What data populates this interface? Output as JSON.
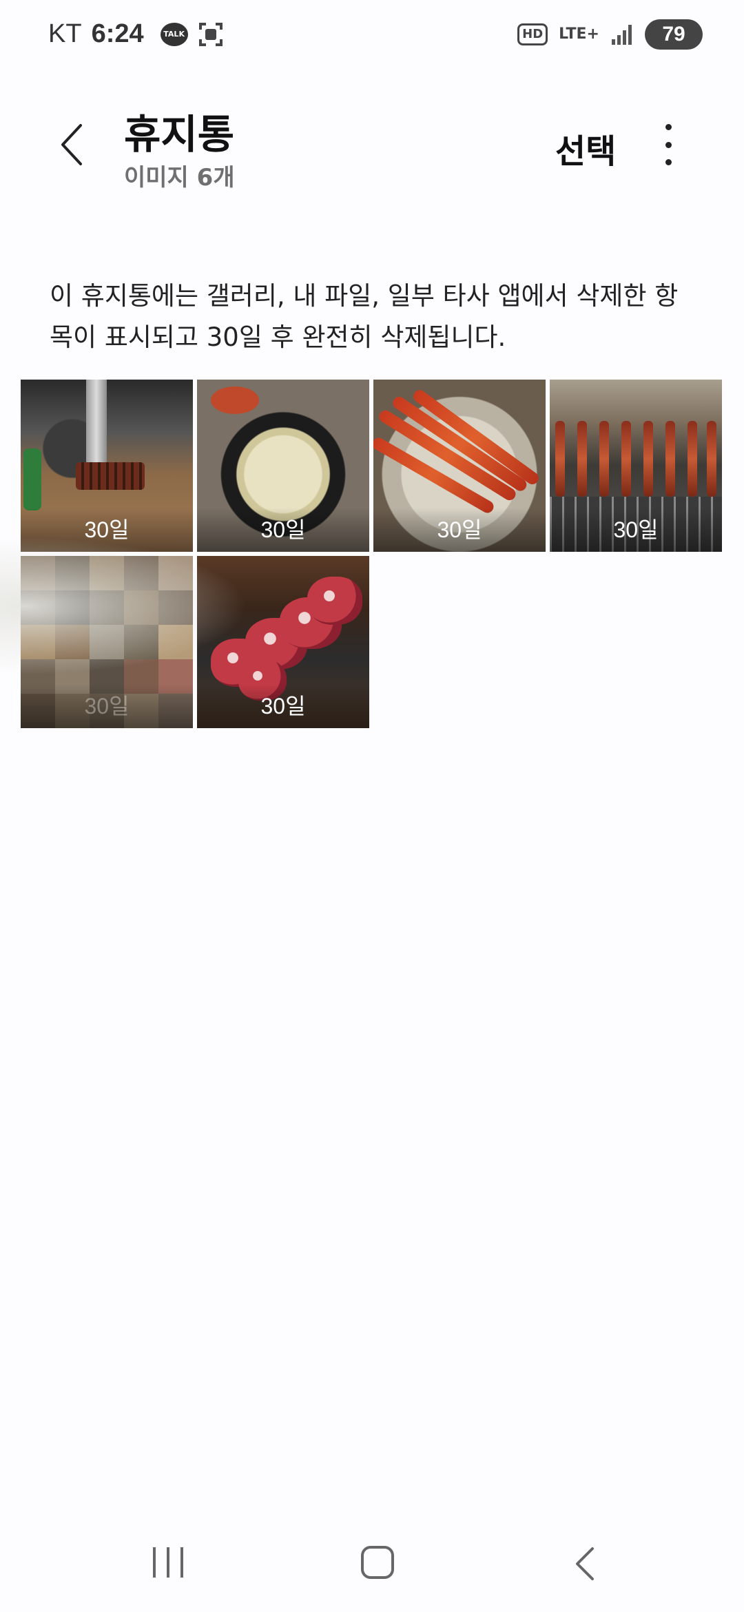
{
  "status_bar": {
    "carrier": "KT",
    "time": "6:24",
    "talk_icon_label": "TALK",
    "hd_label": "HD",
    "network_label": "LTE+",
    "battery_level": "79"
  },
  "app_bar": {
    "title": "휴지통",
    "subtitle": "이미지 6개",
    "select_label": "선택"
  },
  "info_text": "이 휴지통에는 갤러리, 내 파일, 일부 타사 앱에서 삭제한 항목이 표시되고 30일 후 완전히 삭제됩니다.",
  "items": [
    {
      "days_left": "30일"
    },
    {
      "days_left": "30일"
    },
    {
      "days_left": "30일"
    },
    {
      "days_left": "30일"
    },
    {
      "days_left": "30일"
    },
    {
      "days_left": "30일"
    }
  ],
  "colors": {
    "background": "#fdfcfe",
    "text_primary": "#111111",
    "text_secondary": "#6f6f6f"
  }
}
